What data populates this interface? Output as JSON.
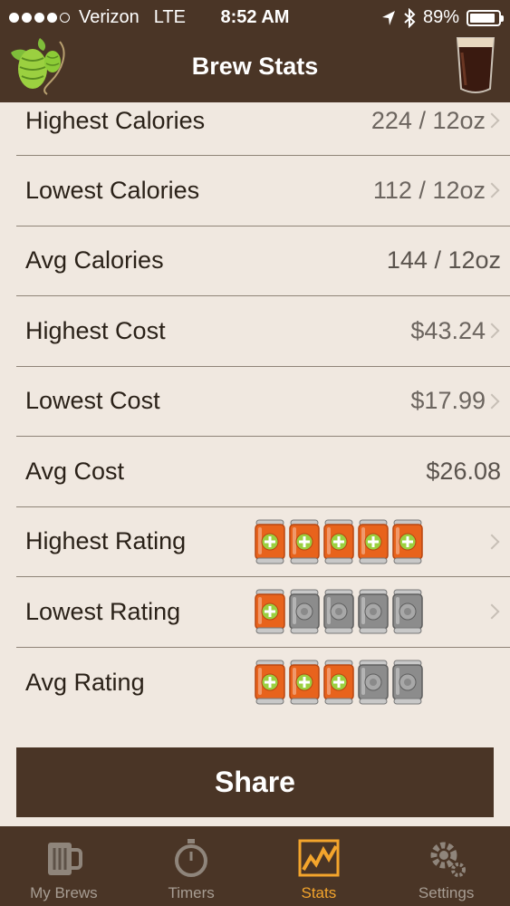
{
  "status_bar": {
    "carrier": "Verizon",
    "network": "LTE",
    "time": "8:52 AM",
    "battery": "89%",
    "battery_level": 0.89,
    "signal_bars": 4
  },
  "header": {
    "title": "Brew Stats",
    "left_icon": "hops-icon",
    "right_icon": "beer-glass-icon"
  },
  "stats": {
    "highest_calories": {
      "label": "Highest Calories",
      "value": "224 / 12oz"
    },
    "lowest_calories": {
      "label": "Lowest Calories",
      "value": "112 / 12oz"
    },
    "avg_calories": {
      "label": "Avg Calories",
      "value": "144 / 12oz"
    },
    "highest_cost": {
      "label": "Highest Cost",
      "value": "$43.24"
    },
    "lowest_cost": {
      "label": "Lowest Cost",
      "value": "$17.99"
    },
    "avg_cost": {
      "label": "Avg Cost",
      "value": "$26.08"
    },
    "highest_rating": {
      "label": "Highest Rating",
      "rating": 5,
      "max": 5
    },
    "lowest_rating": {
      "label": "Lowest Rating",
      "rating": 1,
      "max": 5
    },
    "avg_rating": {
      "label": "Avg Rating",
      "rating": 3,
      "max": 5
    }
  },
  "share_label": "Share",
  "tabs": [
    {
      "label": "My Brews",
      "icon": "beer-mug-icon",
      "active": false
    },
    {
      "label": "Timers",
      "icon": "stopwatch-icon",
      "active": false
    },
    {
      "label": "Stats",
      "icon": "chart-icon",
      "active": true
    },
    {
      "label": "Settings",
      "icon": "gear-icon",
      "active": false
    }
  ],
  "colors": {
    "brown": "#4a3526",
    "background": "#f0e8e0",
    "active_tab": "#f4a52c",
    "can_orange": "#e8631c",
    "can_grey": "#8c8c8c"
  }
}
